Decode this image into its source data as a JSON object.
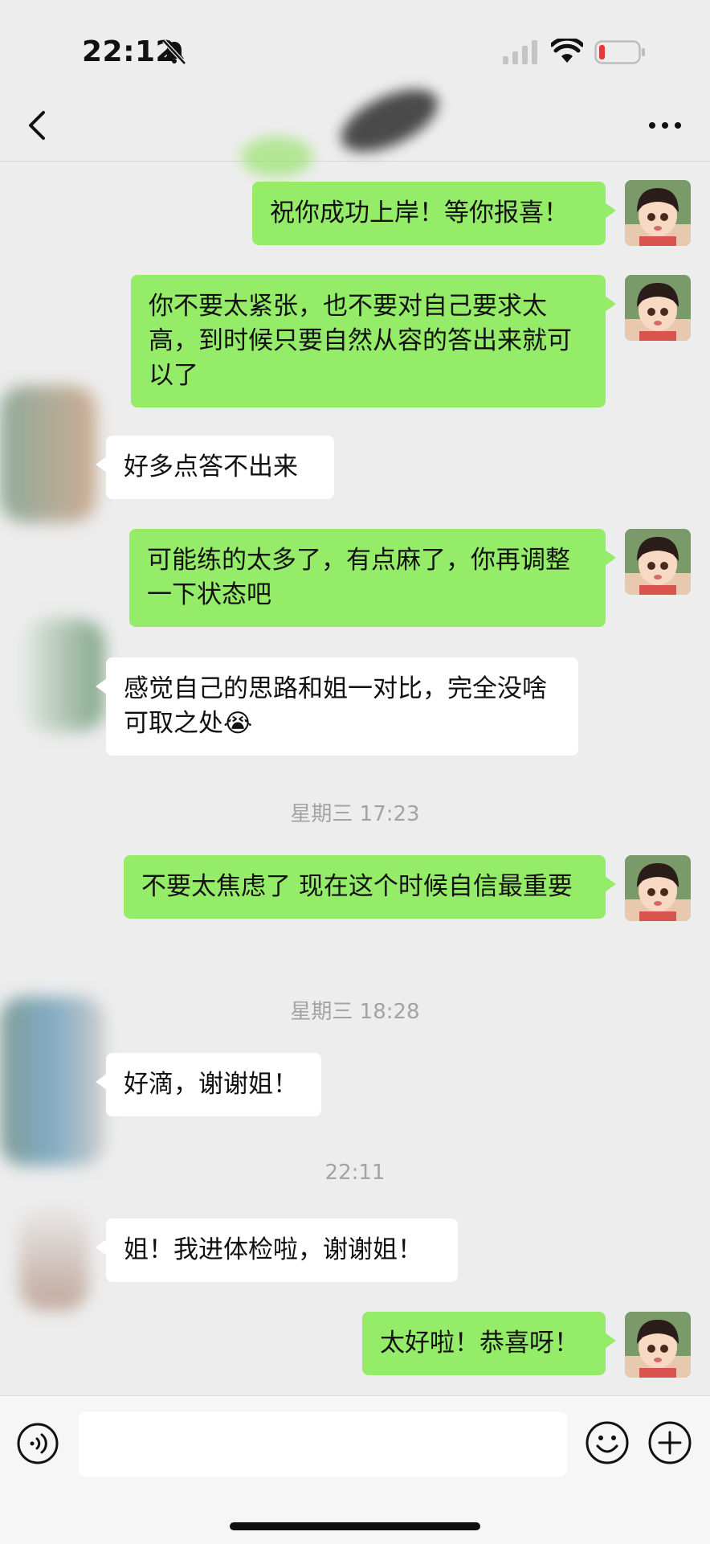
{
  "status_bar": {
    "time": "22:12",
    "icons": [
      "bell-off-icon",
      "signal-icon",
      "wifi-icon",
      "battery-low-icon"
    ]
  },
  "nav": {
    "back_icon": "chevron-left-icon",
    "more_icon": "more-dots-icon"
  },
  "messages": [
    {
      "side": "me",
      "text": "祝你成功上岸！等你报喜！"
    },
    {
      "side": "me",
      "text": "你不要太紧张，也不要对自己要求太高，到时候只要自然从容的答出来就可以了"
    },
    {
      "side": "them",
      "text": "好多点答不出来"
    },
    {
      "side": "me",
      "text": "可能练的太多了，有点麻了，你再调整一下状态吧"
    },
    {
      "side": "them",
      "text": "感觉自己的思路和姐一对比，完全没啥可取之处😭"
    },
    {
      "type": "timestamp",
      "text": "星期三 17:23"
    },
    {
      "side": "me",
      "text": "不要太焦虑了 现在这个时候自信最重要"
    },
    {
      "type": "timestamp",
      "text": "星期三 18:28"
    },
    {
      "side": "them",
      "text": "好滴，谢谢姐！"
    },
    {
      "type": "timestamp",
      "text": "22:11"
    },
    {
      "side": "them",
      "text": "姐！我进体检啦，谢谢姐！"
    },
    {
      "side": "me",
      "text": "太好啦！恭喜呀！"
    }
  ],
  "input_bar": {
    "voice_icon": "voice-icon",
    "input_value": "",
    "emoji_icon": "emoji-icon",
    "plus_icon": "plus-icon"
  },
  "colors": {
    "background": "#ededed",
    "my_bubble": "#95ec69",
    "their_bubble": "#ffffff",
    "timestamp": "#a3a3a3",
    "battery_low": "#e53935"
  }
}
